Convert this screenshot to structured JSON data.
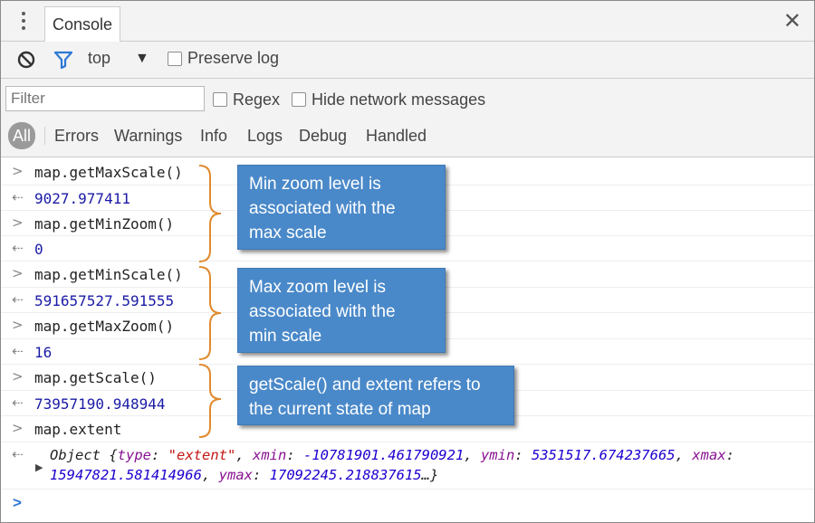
{
  "tabs": {
    "console_label": "Console"
  },
  "toolbar": {
    "context": "top",
    "preserve_log": "Preserve log"
  },
  "filter": {
    "placeholder": "Filter",
    "regex": "Regex",
    "hide_network": "Hide network messages"
  },
  "levels": [
    "All",
    "Errors",
    "Warnings",
    "Info",
    "Logs",
    "Debug",
    "Handled"
  ],
  "console_rows": [
    {
      "type": "in",
      "text": "map.getMaxScale()"
    },
    {
      "type": "out",
      "text": "9027.977411"
    },
    {
      "type": "in",
      "text": "map.getMinZoom()"
    },
    {
      "type": "out",
      "text": "0"
    },
    {
      "type": "in",
      "text": "map.getMinScale()"
    },
    {
      "type": "out",
      "text": "591657527.591555"
    },
    {
      "type": "in",
      "text": "map.getMaxZoom()"
    },
    {
      "type": "out",
      "text": "16"
    },
    {
      "type": "in",
      "text": "map.getScale()"
    },
    {
      "type": "out",
      "text": "73957190.948944"
    },
    {
      "type": "in",
      "text": "map.extent"
    }
  ],
  "object_output": {
    "prefix": "Object {",
    "type_key": "type",
    "type_val": "\"extent\"",
    "xmin_key": "xmin",
    "xmin_val": "-10781901.461790921",
    "ymin_key": "ymin",
    "ymin_val": "5351517.674237665",
    "xmax_key": "xmax",
    "xmax_val": "15947821.581414966",
    "ymax_key": "ymax",
    "ymax_val": "17092245.218837615",
    "suffix": "…}"
  },
  "callouts": {
    "c1": [
      "Min zoom level is",
      "associated with the",
      "max scale"
    ],
    "c2": [
      "Max zoom level is",
      "associated with the",
      "min scale"
    ],
    "c3": [
      "getScale() and extent refers to",
      "the current state of map"
    ]
  },
  "colors": {
    "callout_bg": "#4a89c9",
    "brace": "#e08a2c",
    "output_number": "#1a1aa6",
    "input_prompt": "#2c78d4"
  }
}
